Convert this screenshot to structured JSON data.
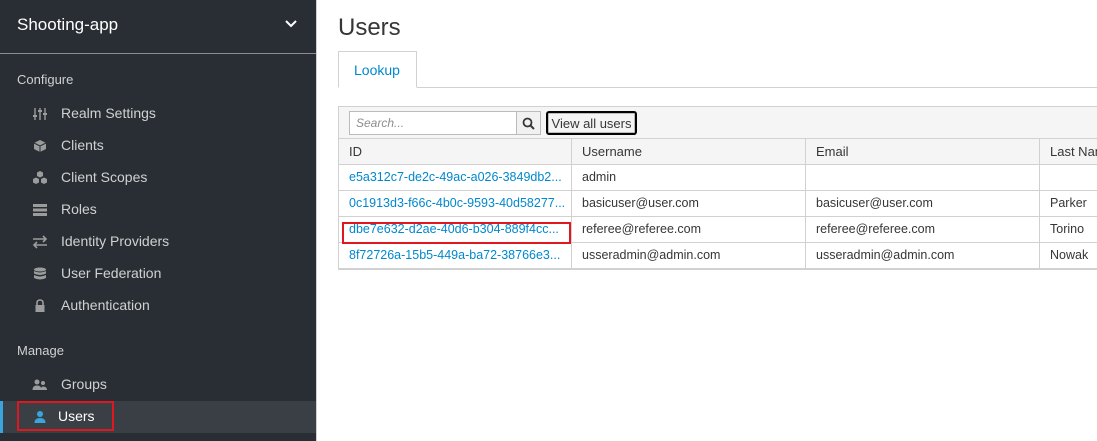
{
  "sidebar": {
    "realm_name": "Shooting-app",
    "configure_label": "Configure",
    "manage_label": "Manage",
    "configure_items": [
      {
        "label": "Realm Settings",
        "icon": "sliders-icon"
      },
      {
        "label": "Clients",
        "icon": "cube-icon"
      },
      {
        "label": "Client Scopes",
        "icon": "cubes-icon"
      },
      {
        "label": "Roles",
        "icon": "roles-icon"
      },
      {
        "label": "Identity Providers",
        "icon": "exchange-icon"
      },
      {
        "label": "User Federation",
        "icon": "database-icon"
      },
      {
        "label": "Authentication",
        "icon": "lock-icon"
      }
    ],
    "manage_items": [
      {
        "label": "Groups",
        "icon": "users-icon"
      },
      {
        "label": "Users",
        "icon": "user-icon",
        "active": true
      }
    ]
  },
  "main": {
    "title": "Users",
    "tabs": [
      {
        "label": "Lookup"
      }
    ],
    "search": {
      "placeholder": "Search...",
      "value": ""
    },
    "view_all_label": "View all users",
    "table": {
      "columns": [
        "ID",
        "Username",
        "Email",
        "Last Name"
      ],
      "rows": [
        {
          "id": "e5a312c7-de2c-49ac-a026-3849db2...",
          "username": "admin",
          "email": "",
          "last_name": ""
        },
        {
          "id": "0c1913d3-f66c-4b0c-9593-40d58277...",
          "username": "basicuser@user.com",
          "email": "basicuser@user.com",
          "last_name": "Parker"
        },
        {
          "id": "dbe7e632-d2ae-40d6-b304-889f4cc...",
          "username": "referee@referee.com",
          "email": "referee@referee.com",
          "last_name": "Torino"
        },
        {
          "id": "8f72726a-15b5-449a-ba72-38766e3...",
          "username": "usseradmin@admin.com",
          "email": "usseradmin@admin.com",
          "last_name": "Nowak"
        }
      ]
    }
  },
  "colors": {
    "sidebar_bg": "#292e34",
    "active_item_bg": "#393f44",
    "accent": "#39a5dc",
    "link": "#0088ce",
    "highlight": "#e0171f"
  }
}
